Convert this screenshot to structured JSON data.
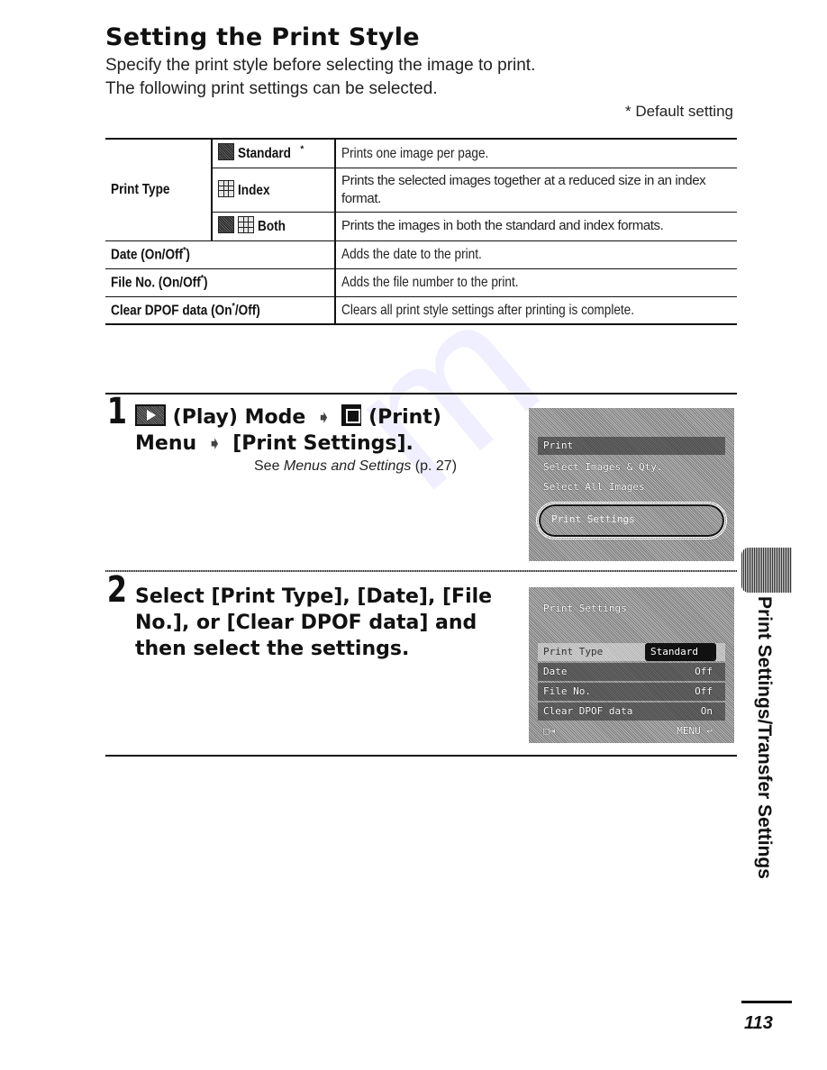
{
  "page": {
    "title": "Setting the Print Style",
    "intro_line1": "Specify the print style before selecting the image to print.",
    "intro_line2": "The following print settings can be selected.",
    "default_note": "* Default setting",
    "page_number": "113",
    "side_tab_label": "Print Settings/Transfer Settings"
  },
  "table": {
    "print_type_label": "Print Type",
    "print_types": [
      {
        "icon": "standard-icon",
        "name": "Standard",
        "default": "*",
        "description": "Prints one image per page."
      },
      {
        "icon": "index-icon",
        "name": "Index",
        "default": "",
        "description": "Prints the selected images together at a reduced size in an index format."
      },
      {
        "icon": "both-icon",
        "name": "Both",
        "default": "",
        "description": "Prints the images in both the standard and index formats."
      }
    ],
    "other_rows": [
      {
        "label_pre": "Date (On/Off",
        "asterisk": "*",
        "label_post": ")",
        "description": "Adds the date to the print."
      },
      {
        "label_pre": "File No. (On/Off",
        "asterisk": "*",
        "label_post": ")",
        "description": "Adds the file number to the print."
      },
      {
        "label_pre": "Clear DPOF data (On",
        "asterisk": "*",
        "label_post": "/Off)",
        "description": "Clears all print style settings after printing is complete."
      }
    ]
  },
  "steps": [
    {
      "number": "1",
      "part1": "(Play) Mode",
      "part2": "(Print)",
      "part3": "Menu",
      "part4": "[Print Settings].",
      "see_prefix": "See ",
      "see_title": "Menus and Settings",
      "see_page": " (p. 27)"
    },
    {
      "number": "2",
      "text": "Select [Print Type], [Date], [File No.], or [Clear DPOF data] and then select the settings."
    }
  ],
  "lcd1": {
    "header": "Print",
    "items": [
      "Select Images & Qty.",
      "Select All Images",
      "Print Settings"
    ]
  },
  "lcd2": {
    "header": "Print Settings",
    "rows": [
      {
        "label": "Print Type",
        "value": "Standard"
      },
      {
        "label": "Date",
        "value": "Off"
      },
      {
        "label": "File No.",
        "value": "Off"
      },
      {
        "label": "Clear DPOF data",
        "value": "On"
      }
    ],
    "footer_left": "□⇥",
    "footer_right": "MENU ↩"
  }
}
